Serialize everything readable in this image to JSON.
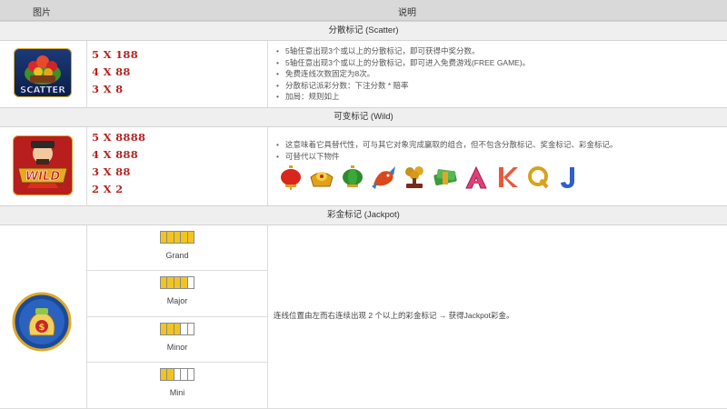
{
  "header": {
    "col_image": "图片",
    "col_desc": "说明"
  },
  "scatter": {
    "title": "分散标记 (Scatter)",
    "icon_text": "SCATTER",
    "payouts": [
      "5 X 188",
      "4 X 88",
      "3 X 8"
    ],
    "rules": [
      "5轴任意出现3个或以上的分散标记，即可获得中奖分数。",
      "5轴任意出现3个或以上的分散标记，即可进入免费游戏(FREE GAME)。",
      "免费连线次数固定为8次。",
      "分散标记派彩分数：下注分数 * 赔率",
      "加局：规则如上"
    ]
  },
  "wild": {
    "title": "可变标记 (Wild)",
    "icon_text": "WILD",
    "payouts": [
      "5 X 8888",
      "4 X 888",
      "3 X 88",
      "2 X 2"
    ],
    "rules": [
      "这意味着它具替代性，可与其它对象完成赢取的组合，但不包含分散标记、奖金标记、彩金标记。",
      "可替代以下物件"
    ],
    "substitutes": [
      {
        "icon": "lantern-icon",
        "color": "#d8261c"
      },
      {
        "icon": "gold-ingot-icon",
        "color": "#e3a11a"
      },
      {
        "icon": "green-lantern-icon",
        "color": "#2e8b2e"
      },
      {
        "icon": "koi-fish-icon",
        "color": "#d84a1c"
      },
      {
        "icon": "bonsai-icon",
        "color": "#c9901a"
      },
      {
        "icon": "jade-bundle-icon",
        "color": "#3d9a3d"
      },
      {
        "icon": "letter-a-icon",
        "glyph": "A",
        "color": "#e0407a"
      },
      {
        "icon": "letter-k-icon",
        "glyph": "K",
        "color": "#e85a3a"
      },
      {
        "icon": "letter-q-icon",
        "glyph": "Q",
        "color": "#d9a21a"
      },
      {
        "icon": "letter-j-icon",
        "glyph": "J",
        "color": "#2f5fc8"
      }
    ]
  },
  "jackpot": {
    "title": "彩金标记 (Jackpot)",
    "levels": [
      {
        "name": "Grand",
        "lit": 5
      },
      {
        "name": "Major",
        "lit": 4
      },
      {
        "name": "Minor",
        "lit": 3
      },
      {
        "name": "Mini",
        "lit": 2
      }
    ],
    "description": "连线位置由左而右连续出现 2 个以上的彩金标记 → 获得Jackpot彩金。"
  },
  "colors": {
    "header_bg": "#d9d9d9",
    "section_bg": "#efefef",
    "payout_red": "#b52222",
    "meter_on": "#f2c41e"
  }
}
